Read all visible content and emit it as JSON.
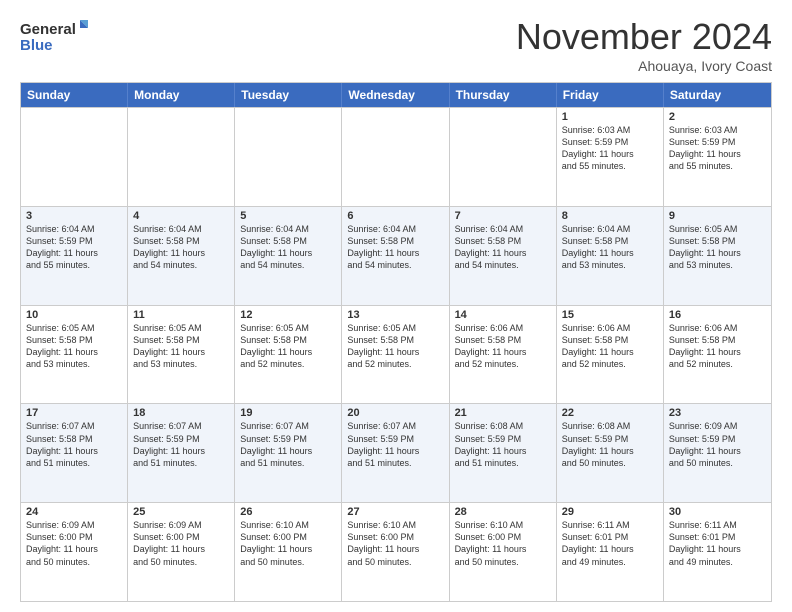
{
  "logo": {
    "line1": "General",
    "line2": "Blue"
  },
  "header": {
    "month": "November 2024",
    "location": "Ahouaya, Ivory Coast"
  },
  "weekdays": [
    "Sunday",
    "Monday",
    "Tuesday",
    "Wednesday",
    "Thursday",
    "Friday",
    "Saturday"
  ],
  "rows": [
    [
      {
        "day": "",
        "text": ""
      },
      {
        "day": "",
        "text": ""
      },
      {
        "day": "",
        "text": ""
      },
      {
        "day": "",
        "text": ""
      },
      {
        "day": "",
        "text": ""
      },
      {
        "day": "1",
        "text": "Sunrise: 6:03 AM\nSunset: 5:59 PM\nDaylight: 11 hours\nand 55 minutes."
      },
      {
        "day": "2",
        "text": "Sunrise: 6:03 AM\nSunset: 5:59 PM\nDaylight: 11 hours\nand 55 minutes."
      }
    ],
    [
      {
        "day": "3",
        "text": "Sunrise: 6:04 AM\nSunset: 5:59 PM\nDaylight: 11 hours\nand 55 minutes."
      },
      {
        "day": "4",
        "text": "Sunrise: 6:04 AM\nSunset: 5:58 PM\nDaylight: 11 hours\nand 54 minutes."
      },
      {
        "day": "5",
        "text": "Sunrise: 6:04 AM\nSunset: 5:58 PM\nDaylight: 11 hours\nand 54 minutes."
      },
      {
        "day": "6",
        "text": "Sunrise: 6:04 AM\nSunset: 5:58 PM\nDaylight: 11 hours\nand 54 minutes."
      },
      {
        "day": "7",
        "text": "Sunrise: 6:04 AM\nSunset: 5:58 PM\nDaylight: 11 hours\nand 54 minutes."
      },
      {
        "day": "8",
        "text": "Sunrise: 6:04 AM\nSunset: 5:58 PM\nDaylight: 11 hours\nand 53 minutes."
      },
      {
        "day": "9",
        "text": "Sunrise: 6:05 AM\nSunset: 5:58 PM\nDaylight: 11 hours\nand 53 minutes."
      }
    ],
    [
      {
        "day": "10",
        "text": "Sunrise: 6:05 AM\nSunset: 5:58 PM\nDaylight: 11 hours\nand 53 minutes."
      },
      {
        "day": "11",
        "text": "Sunrise: 6:05 AM\nSunset: 5:58 PM\nDaylight: 11 hours\nand 53 minutes."
      },
      {
        "day": "12",
        "text": "Sunrise: 6:05 AM\nSunset: 5:58 PM\nDaylight: 11 hours\nand 52 minutes."
      },
      {
        "day": "13",
        "text": "Sunrise: 6:05 AM\nSunset: 5:58 PM\nDaylight: 11 hours\nand 52 minutes."
      },
      {
        "day": "14",
        "text": "Sunrise: 6:06 AM\nSunset: 5:58 PM\nDaylight: 11 hours\nand 52 minutes."
      },
      {
        "day": "15",
        "text": "Sunrise: 6:06 AM\nSunset: 5:58 PM\nDaylight: 11 hours\nand 52 minutes."
      },
      {
        "day": "16",
        "text": "Sunrise: 6:06 AM\nSunset: 5:58 PM\nDaylight: 11 hours\nand 52 minutes."
      }
    ],
    [
      {
        "day": "17",
        "text": "Sunrise: 6:07 AM\nSunset: 5:58 PM\nDaylight: 11 hours\nand 51 minutes."
      },
      {
        "day": "18",
        "text": "Sunrise: 6:07 AM\nSunset: 5:59 PM\nDaylight: 11 hours\nand 51 minutes."
      },
      {
        "day": "19",
        "text": "Sunrise: 6:07 AM\nSunset: 5:59 PM\nDaylight: 11 hours\nand 51 minutes."
      },
      {
        "day": "20",
        "text": "Sunrise: 6:07 AM\nSunset: 5:59 PM\nDaylight: 11 hours\nand 51 minutes."
      },
      {
        "day": "21",
        "text": "Sunrise: 6:08 AM\nSunset: 5:59 PM\nDaylight: 11 hours\nand 51 minutes."
      },
      {
        "day": "22",
        "text": "Sunrise: 6:08 AM\nSunset: 5:59 PM\nDaylight: 11 hours\nand 50 minutes."
      },
      {
        "day": "23",
        "text": "Sunrise: 6:09 AM\nSunset: 5:59 PM\nDaylight: 11 hours\nand 50 minutes."
      }
    ],
    [
      {
        "day": "24",
        "text": "Sunrise: 6:09 AM\nSunset: 6:00 PM\nDaylight: 11 hours\nand 50 minutes."
      },
      {
        "day": "25",
        "text": "Sunrise: 6:09 AM\nSunset: 6:00 PM\nDaylight: 11 hours\nand 50 minutes."
      },
      {
        "day": "26",
        "text": "Sunrise: 6:10 AM\nSunset: 6:00 PM\nDaylight: 11 hours\nand 50 minutes."
      },
      {
        "day": "27",
        "text": "Sunrise: 6:10 AM\nSunset: 6:00 PM\nDaylight: 11 hours\nand 50 minutes."
      },
      {
        "day": "28",
        "text": "Sunrise: 6:10 AM\nSunset: 6:00 PM\nDaylight: 11 hours\nand 50 minutes."
      },
      {
        "day": "29",
        "text": "Sunrise: 6:11 AM\nSunset: 6:01 PM\nDaylight: 11 hours\nand 49 minutes."
      },
      {
        "day": "30",
        "text": "Sunrise: 6:11 AM\nSunset: 6:01 PM\nDaylight: 11 hours\nand 49 minutes."
      }
    ]
  ],
  "altRows": [
    1,
    3
  ]
}
